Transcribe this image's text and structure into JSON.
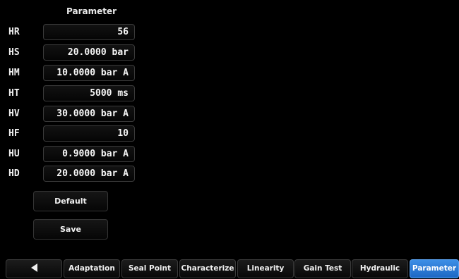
{
  "header": {
    "parameter_label": "Parameter"
  },
  "rows": [
    {
      "label": "HR",
      "value": "56"
    },
    {
      "label": "HS",
      "value": "20.0000 bar"
    },
    {
      "label": "HM",
      "value": "10.0000 bar A"
    },
    {
      "label": "HT",
      "value": "5000 ms"
    },
    {
      "label": "HV",
      "value": "30.0000 bar A"
    },
    {
      "label": "HF",
      "value": "10"
    },
    {
      "label": "HU",
      "value": "0.9000 bar A"
    },
    {
      "label": "HD",
      "value": "20.0000 bar A"
    }
  ],
  "buttons": {
    "default_label": "Default",
    "save_label": "Save"
  },
  "tabs": [
    {
      "label": "",
      "icon": "back-arrow-icon"
    },
    {
      "label": "Adaptation"
    },
    {
      "label": "Seal Point"
    },
    {
      "label": "Characterize"
    },
    {
      "label": "Linearity"
    },
    {
      "label": "Gain Test"
    },
    {
      "label": "Hydraulic"
    },
    {
      "label": "Parameter",
      "active": true
    }
  ],
  "colors": {
    "active_tab": "#2f7fdc",
    "background": "#000000"
  }
}
